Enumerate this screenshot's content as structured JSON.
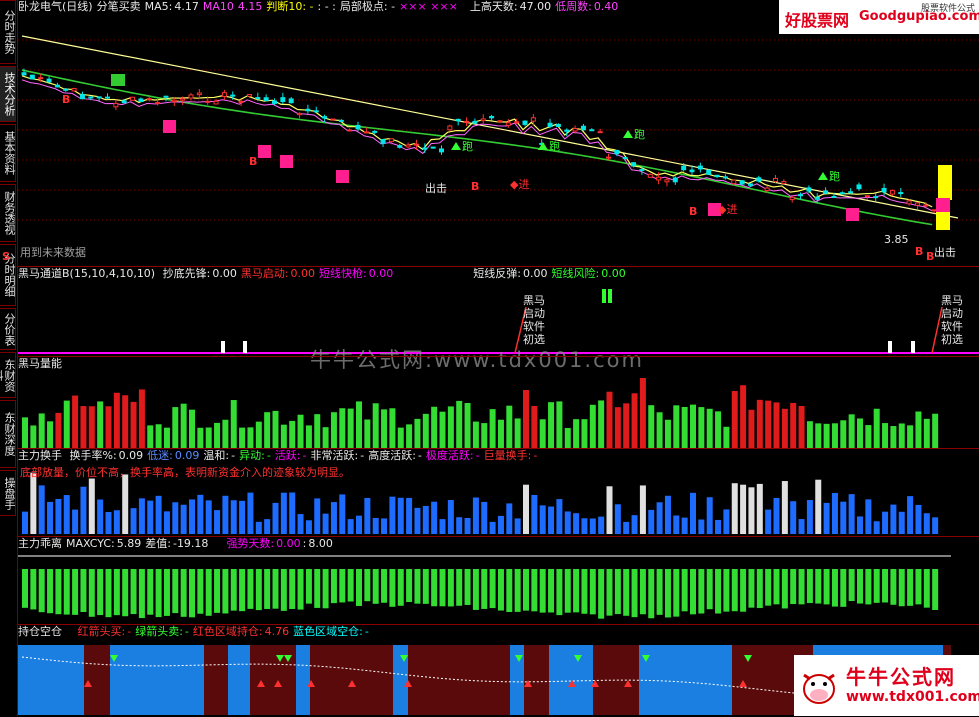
{
  "sidebar": {
    "tabs": [
      {
        "label": "分时走势",
        "active": false
      },
      {
        "label": "技术分析",
        "active": true
      },
      {
        "label": "基本资料",
        "active": false
      },
      {
        "label": "财务透视",
        "active": false
      },
      {
        "label": "分时明细",
        "active": false
      },
      {
        "label": "分价表",
        "active": false
      },
      {
        "label": "东财资料",
        "active": false
      },
      {
        "label": "东财深度",
        "active": false
      },
      {
        "label": "操盘手",
        "active": false
      }
    ],
    "s_mark": "S"
  },
  "price_panel": {
    "stock": "卧龙电气(日线)",
    "mode": "分笔买卖",
    "ma5_label": "MA5:",
    "ma5_value": "4.17",
    "ma10_label": "MA10",
    "ma10_value": "4.15",
    "judge": "判断10: -",
    "sep": ": - :",
    "local_pole": "局部极点: -",
    "stars": "××× ×××",
    "up_days_label": "上高天数:",
    "up_days_value": "47.00",
    "low_weeks_label": "低周数:",
    "low_weeks_value": "0.40",
    "future_data": "用到未来数据",
    "low_price": "3.85",
    "out_label": "出击",
    "signals": {
      "jump": "跑",
      "buy": "B",
      "enter": "进",
      "out": "出击"
    }
  },
  "logo_top": {
    "cn": "好股票网",
    "en": "Goodgupiao.com",
    "sub": "股票软件公式"
  },
  "heima_panel": {
    "title": "黑马通道B(15,10,4,10,10)",
    "items": [
      {
        "label": "抄底先锋:",
        "value": "0.00",
        "color": "white"
      },
      {
        "label": "黑马启动:",
        "value": "0.00",
        "color": "red"
      },
      {
        "label": "短线快枪:",
        "value": "0.00",
        "color": "magenta"
      },
      {
        "label": "短线反弹:",
        "value": "0.00",
        "color": "white"
      },
      {
        "label": "短线风险:",
        "value": "0.00",
        "color": "green"
      }
    ],
    "callout": [
      "黑马",
      "启动",
      "软件",
      "初选"
    ]
  },
  "watermark": "牛牛公式网:www.tdx001.com",
  "volume_panel": {
    "title": "黑马量能"
  },
  "turnover_panel": {
    "title": "主力换手",
    "items": [
      {
        "label": "换手率%:",
        "value": "0.09",
        "color": "white"
      },
      {
        "label": "低迷:",
        "value": "0.09",
        "color": "blue"
      },
      {
        "label": "温和:",
        "value": "-",
        "color": "white"
      },
      {
        "label": "异动:",
        "value": "-",
        "color": "green"
      },
      {
        "label": "活跃:",
        "value": "-",
        "color": "magenta"
      },
      {
        "label": "非常活跃:",
        "value": "-",
        "color": "white"
      },
      {
        "label": "高度活跃:",
        "value": "-",
        "color": "white"
      },
      {
        "label": "极度活跃:",
        "value": "-",
        "color": "magenta"
      },
      {
        "label": "巨量换手:",
        "value": "-",
        "color": "red"
      }
    ],
    "note": "底部放量，价位不高，换手率高，表明新资金介入的迹象较为明显。"
  },
  "deviation_panel": {
    "title": "主力乖离",
    "maxcyc_label": "MAXCYC:",
    "maxcyc_value": "5.89",
    "diff_label": "差值:",
    "diff_value": "-19.18",
    "strong_label": "强势天数:",
    "strong_value": "0.00",
    "strong_sep": ":",
    "strong_value2": "8.00"
  },
  "position_panel": {
    "title": "持仓空仓",
    "items": [
      {
        "label": "红箭头买:",
        "value": "-",
        "color": "red"
      },
      {
        "label": "绿箭头卖:",
        "value": "-",
        "color": "green"
      },
      {
        "label": "红色区域持仓:",
        "value": "4.76",
        "color": "red"
      },
      {
        "label": "蓝色区域空仓:",
        "value": "-",
        "color": "cyan"
      }
    ]
  },
  "logo_bottom": {
    "cn": "牛牛公式网",
    "en": "www.tdx001.com"
  },
  "colors": {
    "up": "#ff3030",
    "down": "#33ff33",
    "blue_bar": "#1e6bff",
    "white_bar": "#e0e0e0",
    "hold_red": "#5a0a0a",
    "empty_blue": "#1a7fe0"
  }
}
